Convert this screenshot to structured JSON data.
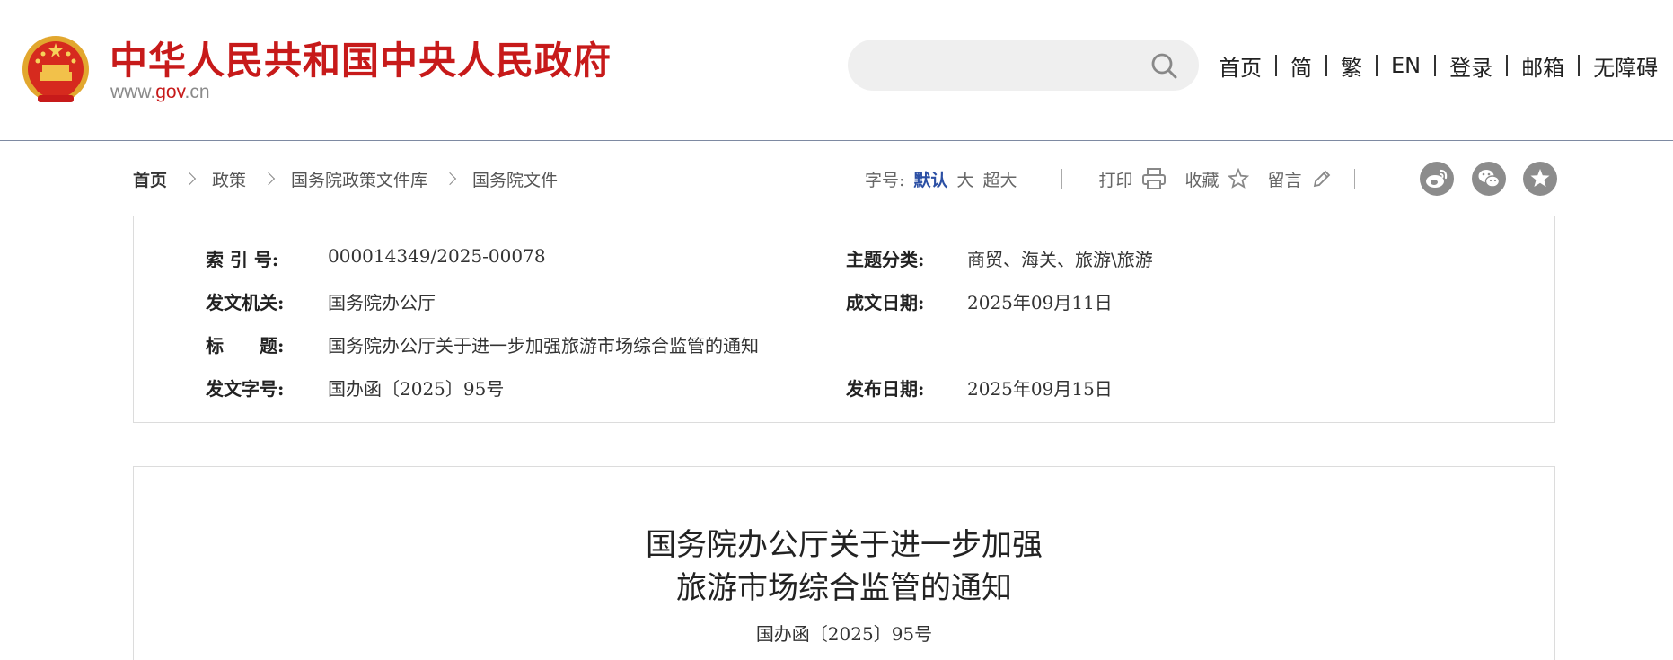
{
  "header": {
    "site_title": "中华人民共和国中央人民政府",
    "domain_prefix": "www.",
    "domain_gov": "gov",
    "domain_suffix": ".cn",
    "search_placeholder": "",
    "nav": [
      "首页",
      "简",
      "繁",
      "EN",
      "登录",
      "邮箱",
      "无障碍"
    ]
  },
  "breadcrumb": [
    "首页",
    "政策",
    "国务院政策文件库",
    "国务院文件"
  ],
  "tools": {
    "font_label": "字号:",
    "sizes": [
      "默认",
      "大",
      "超大"
    ],
    "active_size": "默认",
    "print": "打印",
    "favorite": "收藏",
    "comment": "留言"
  },
  "social_icons": [
    "weibo-icon",
    "wechat-icon",
    "star-icon"
  ],
  "meta": {
    "index_label": "索 引 号:",
    "index_value": "000014349/2025-00078",
    "topic_label": "主题分类:",
    "topic_value": "商贸、海关、旅游\\旅游",
    "issuer_label": "发文机关:",
    "issuer_value": "国务院办公厅",
    "written_label": "成文日期:",
    "written_value": "2025年09月11日",
    "title_label": "标　　题:",
    "title_value": "国务院办公厅关于进一步加强旅游市场综合监管的通知",
    "docno_label": "发文字号:",
    "docno_value": "国办函〔2025〕95号",
    "published_label": "发布日期:",
    "published_value": "2025年09月15日"
  },
  "article": {
    "title_line1": "国务院办公厅关于进一步加强",
    "title_line2": "旅游市场综合监管的通知",
    "doc_number": "国办函〔2025〕95号"
  },
  "colors": {
    "brand_red": "#c71a1a",
    "accent_blue": "#2b4fa4",
    "header_rule": "#7e8aa2",
    "social_gray": "#8c8c8c"
  }
}
